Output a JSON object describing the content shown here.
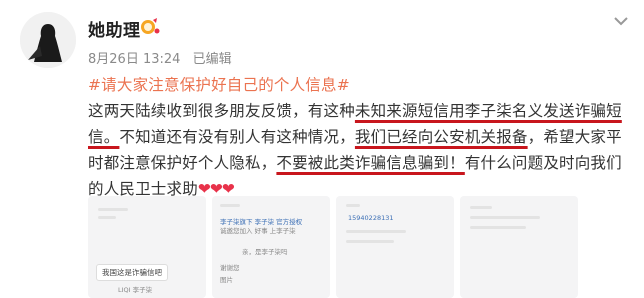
{
  "post": {
    "author": "她助理",
    "date": "8月26日 13:24",
    "edited": "已编辑",
    "topic": "#请大家注意保护好自己的个人信息#",
    "body": {
      "t1": "这两天陆续收到很多朋友反馈，有这种",
      "u1": "未知来源短信用李子柒名义发送诈骗短信。",
      "t2": "不知道还有没有别人有这种情况，",
      "u2": "我们已经向公安机关报备",
      "t3": "，希望大家平时都注意保护好个人隐私，",
      "u3": "不要被此类诈骗信息骗到！",
      "t4": "有什么问题及时向我们的人民卫士求助",
      "hearts": "❤❤❤"
    }
  },
  "thumbnails": {
    "t1": {
      "bubble": "我国这是诈骗信吧",
      "caption": "LIQI 李子柒"
    },
    "t2": {
      "line1": "李子柒旗下 李子柒 官方授权",
      "line2": "诚邀您加入 好事 上李子柒",
      "line3": "亲，是李子柒吗",
      "line4": "谢谢您",
      "line5": "图片"
    },
    "t3": {
      "number": "15940228131"
    }
  },
  "colors": {
    "topic": "#eb7350",
    "underline": "#c8161d",
    "heart": "#e8324a",
    "meta": "#8a8a8a"
  },
  "icons": [
    "avatar-image",
    "vip-badge-icon",
    "chevron-down-icon",
    "heart-icon"
  ]
}
